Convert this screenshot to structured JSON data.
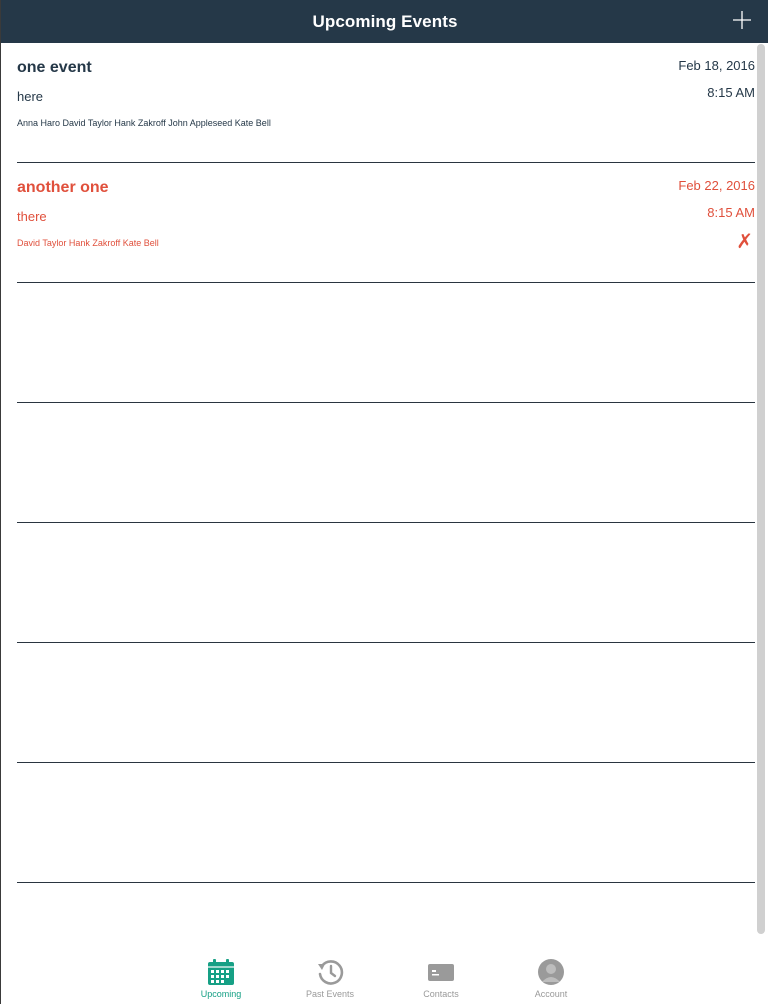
{
  "colors": {
    "navbar": "#253848",
    "primary_text": "#253848",
    "accent_red": "#e0503c",
    "tab_active": "#16a085",
    "tab_inactive": "#9a9a9a"
  },
  "navbar": {
    "title": "Upcoming Events",
    "add_icon": "plus-icon"
  },
  "events": [
    {
      "title": "one event",
      "location": "here",
      "attendees": "Anna Haro David Taylor Hank Zakroff John Appleseed Kate Bell",
      "date": "Feb 18, 2016",
      "time": "8:15 AM",
      "cancel": ""
    },
    {
      "title": "another one",
      "location": "there",
      "attendees": "David Taylor Hank Zakroff Kate Bell",
      "date": "Feb 22, 2016",
      "time": "8:15 AM",
      "cancel": "✗"
    }
  ],
  "tabbar": {
    "tabs": [
      {
        "label": "Upcoming",
        "icon": "calendar-icon",
        "active": true
      },
      {
        "label": "Past Events",
        "icon": "history-icon",
        "active": false
      },
      {
        "label": "Contacts",
        "icon": "contact-card-icon",
        "active": false
      },
      {
        "label": "Account",
        "icon": "account-icon",
        "active": false
      }
    ]
  }
}
